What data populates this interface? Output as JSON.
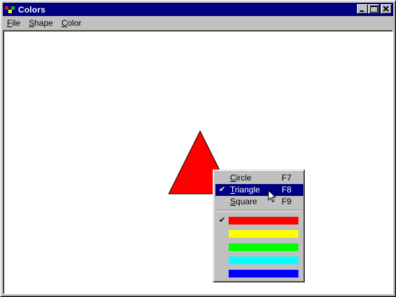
{
  "window": {
    "title": "Colors",
    "controls": [
      "minimize",
      "maximize",
      "close"
    ]
  },
  "menubar": {
    "items": [
      {
        "label": "File",
        "accel": "F",
        "rest": "ile"
      },
      {
        "label": "Shape",
        "accel": "S",
        "rest": "hape"
      },
      {
        "label": "Color",
        "accel": "C",
        "rest": "olor"
      }
    ]
  },
  "canvas": {
    "shape": "triangle",
    "fill": "#ff0000"
  },
  "context_menu": {
    "shape_items": [
      {
        "accel": "C",
        "rest": "ircle",
        "label": "Circle",
        "shortcut": "F7",
        "checked": false,
        "highlighted": false
      },
      {
        "accel": "T",
        "rest": "riangle",
        "label": "Triangle",
        "shortcut": "F8",
        "checked": true,
        "highlighted": true
      },
      {
        "accel": "S",
        "rest": "quare",
        "label": "Square",
        "shortcut": "F9",
        "checked": false,
        "highlighted": false
      }
    ],
    "check_glyph": "✔",
    "color_items": [
      {
        "color": "#ff0000",
        "name": "red",
        "checked": true
      },
      {
        "color": "#ffff00",
        "name": "yellow",
        "checked": false
      },
      {
        "color": "#00ff00",
        "name": "green",
        "checked": false
      },
      {
        "color": "#00ffff",
        "name": "cyan",
        "checked": false
      },
      {
        "color": "#0000ff",
        "name": "blue",
        "checked": false
      }
    ]
  },
  "colors": {
    "titlebar": "#000080",
    "face": "#c0c0c0",
    "highlight": "#000080"
  }
}
